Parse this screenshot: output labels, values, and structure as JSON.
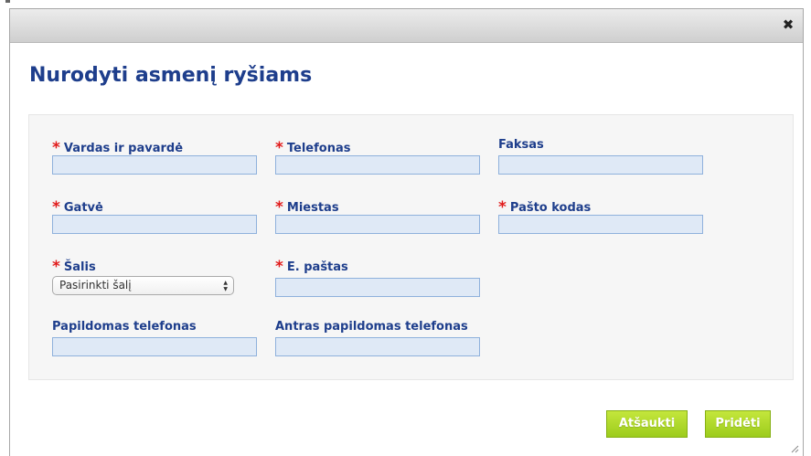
{
  "dialog": {
    "title": "Nurodyti asmenį ryšiams",
    "close_icon": "close-icon",
    "close_glyph": "✖"
  },
  "form": {
    "required_marker": "*",
    "fields": {
      "full_name": {
        "label": "Vardas ir pavardė",
        "required": true,
        "value": ""
      },
      "phone": {
        "label": "Telefonas",
        "required": true,
        "value": ""
      },
      "fax": {
        "label": "Faksas",
        "required": false,
        "value": ""
      },
      "street": {
        "label": "Gatvė",
        "required": true,
        "value": ""
      },
      "city": {
        "label": "Miestas",
        "required": true,
        "value": ""
      },
      "postal_code": {
        "label": "Pašto kodas",
        "required": true,
        "value": ""
      },
      "country": {
        "label": "Šalis",
        "required": true,
        "selected": "Pasirinkti šalį"
      },
      "email": {
        "label": "E. paštas",
        "required": true,
        "value": ""
      },
      "extra_phone": {
        "label": "Papildomas telefonas",
        "required": false,
        "value": ""
      },
      "second_extra_phone": {
        "label": "Antras papildomas telefonas",
        "required": false,
        "value": ""
      }
    }
  },
  "buttons": {
    "cancel": "Atšaukti",
    "add": "Pridėti"
  },
  "colors": {
    "title": "#1e3e8c",
    "required": "#e11b1b",
    "input_bg": "#dfe9f6",
    "input_border": "#8fb1dc",
    "button_green": "#a8d42a"
  }
}
